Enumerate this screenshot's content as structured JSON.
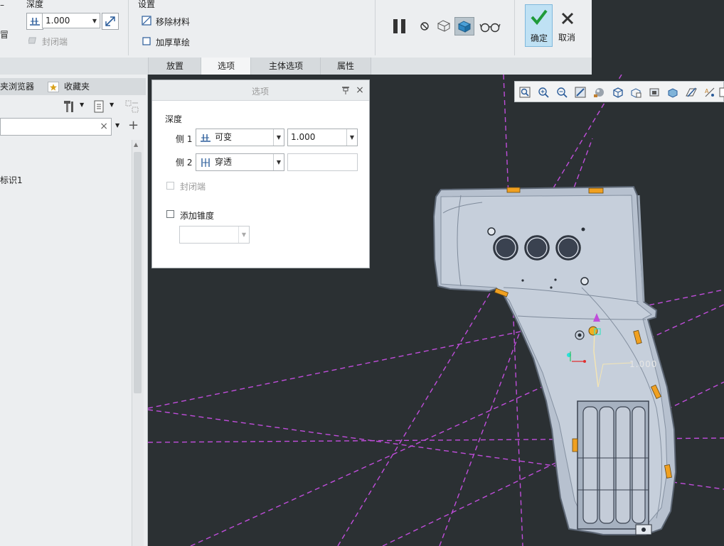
{
  "ribbon": {
    "depth_group_label": "深度",
    "depth_value": "1.000",
    "capped_ends_label": "封闭端",
    "settings_group_label": "设置",
    "remove_material_label": "移除材料",
    "thicken_sketch_label": "加厚草绘",
    "ok_label": "确定",
    "cancel_label": "取消",
    "tabs": [
      "放置",
      "选项",
      "主体选项",
      "属性"
    ],
    "active_tab": "选项"
  },
  "left_panel": {
    "tabs": [
      "夹浏览器",
      "收藏夹"
    ],
    "tree_item": "标识1"
  },
  "options_panel": {
    "title": "选项",
    "depth_section": "深度",
    "side1_label": "侧 1",
    "side1_type": "可变",
    "side1_value": "1.000",
    "side2_label": "侧 2",
    "side2_type": "穿透",
    "side2_value": "",
    "capped_ends_label": "封闭端",
    "add_taper_label": "添加锥度",
    "taper_value": ""
  },
  "viewport": {
    "dimension_label": "1.000"
  },
  "icons": {
    "depth_type": "blind-depth-icon",
    "flip": "flip-direction-icon",
    "pause": "pause-icon",
    "no_preview": "no-preview-icon",
    "preview_geometry": "geometry-preview-icon",
    "preview_feature": "feature-preview-icon",
    "verify": "glasses-icon",
    "ok": "check-icon",
    "cancel": "cross-icon"
  },
  "colors": {
    "ribbon_bg": "#eceef0",
    "viewport_bg": "#2b3033",
    "model_fill": "#b7c1cf",
    "datum_lines": "#c04ddb",
    "ok_button": "#bfe1f4",
    "check_green": "#1f9a3a",
    "highlight_orange": "#f0a020"
  }
}
